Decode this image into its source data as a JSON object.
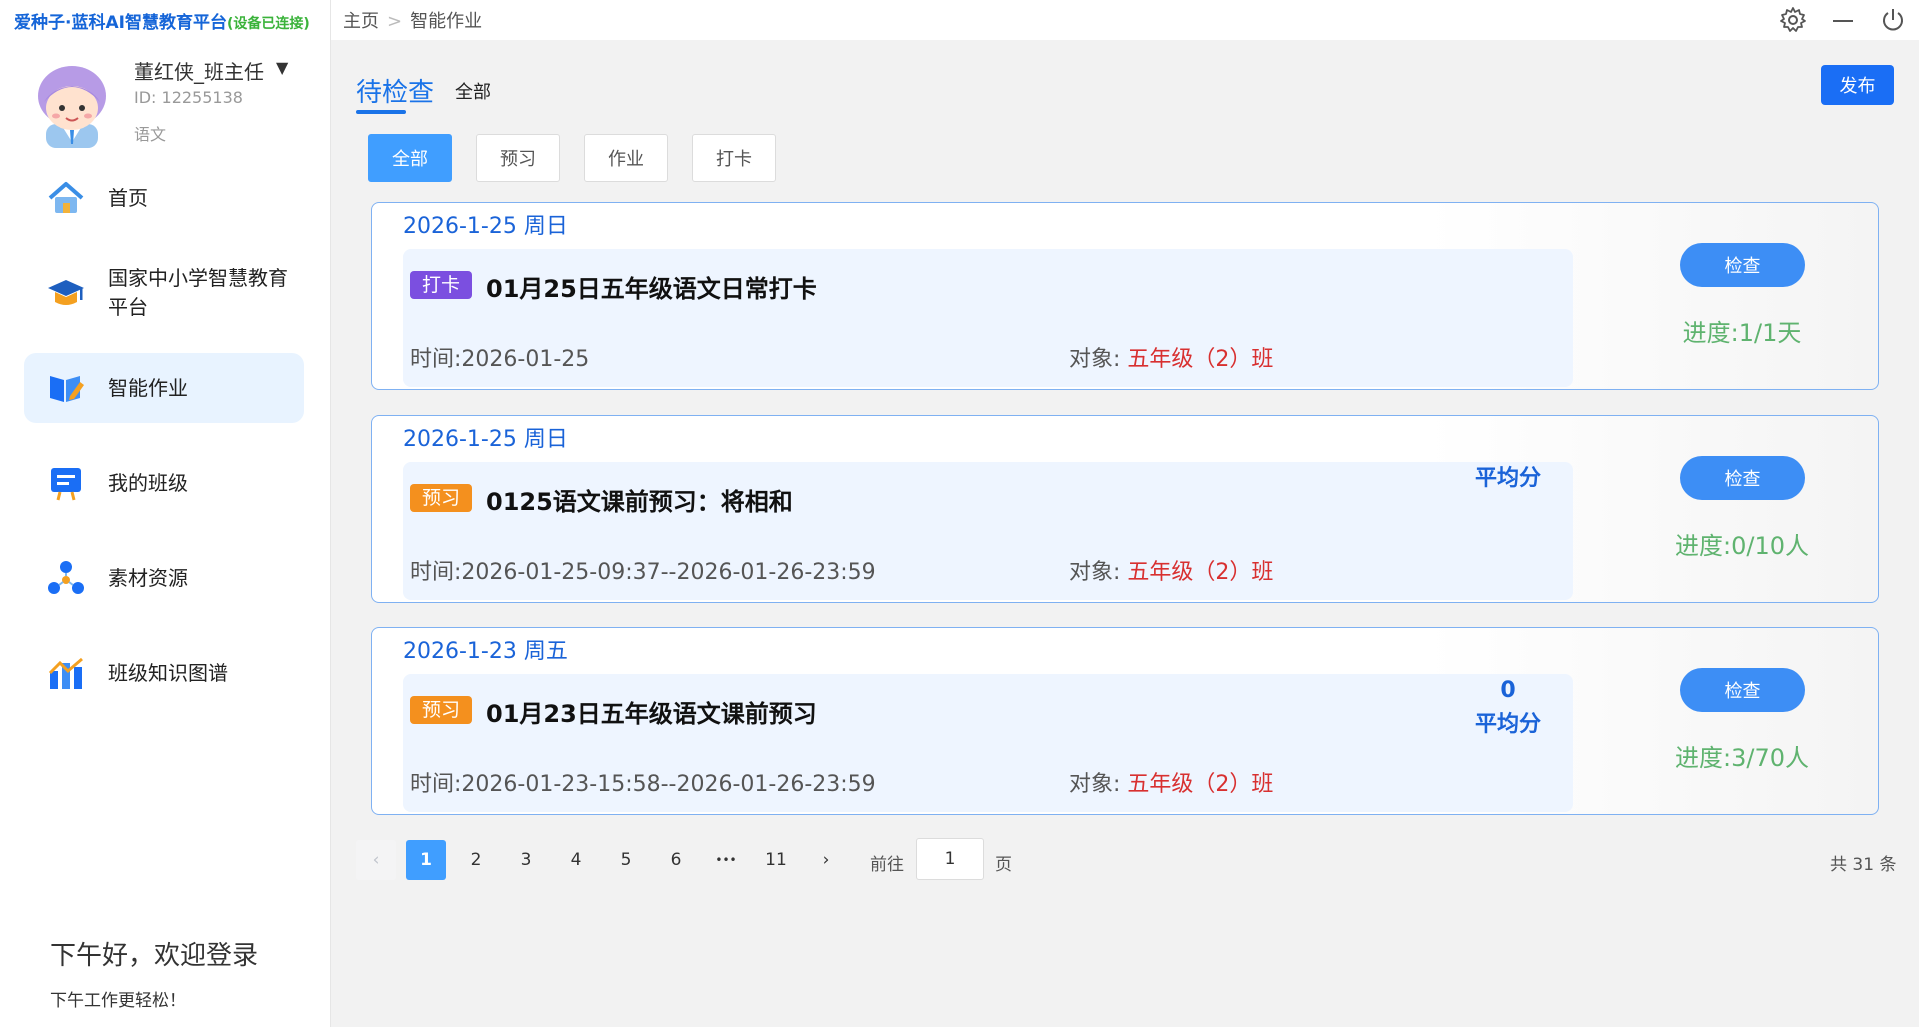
{
  "app": {
    "title": "爱种子·蓝科AI智慧教育平台",
    "connection": "(设备已连接)"
  },
  "user": {
    "name": "董红侠_班主任",
    "caret": "▼",
    "id": "ID: 12255138",
    "subject": "语文"
  },
  "nav": [
    {
      "label": "首页",
      "icon": "home-icon"
    },
    {
      "label": "国家中小学智慧教育平台",
      "icon": "graduation-cap-icon"
    },
    {
      "label": "智能作业",
      "icon": "book-pen-icon",
      "active": true
    },
    {
      "label": "我的班级",
      "icon": "class-board-icon"
    },
    {
      "label": "素材资源",
      "icon": "resources-icon"
    },
    {
      "label": "班级知识图谱",
      "icon": "chart-icon"
    }
  ],
  "greeting": {
    "title": "下午好，欢迎登录",
    "sub": "下午工作更轻松！"
  },
  "breadcrumb": {
    "home": "主页",
    "sep": ">",
    "current": "智能作业"
  },
  "tabs": {
    "pending": "待检查",
    "all": "全部"
  },
  "publish_label": "发布",
  "filters": [
    "全部",
    "预习",
    "作业",
    "打卡"
  ],
  "cards": [
    {
      "date": "2026-1-25 周日",
      "badge": "打卡",
      "badge_color": "#7b4fe0",
      "title": "01月25日五年级语文日常打卡",
      "time": "时间:2026-01-25",
      "target_label": "对象:",
      "target_class": "五年级（2）班",
      "avg_score": "",
      "avg_label": "",
      "check_label": "检查",
      "progress": "进度:1/1天"
    },
    {
      "date": "2026-1-25 周日",
      "badge": "预习",
      "badge_color": "#f4901e",
      "title": "0125语文课前预习：将相和",
      "time": "时间:2026-01-25-09:37--2026-01-26-23:59",
      "target_label": "对象:",
      "target_class": "五年级（2）班",
      "avg_score": "",
      "avg_label": "平均分",
      "check_label": "检查",
      "progress": "进度:0/10人"
    },
    {
      "date": "2026-1-23 周五",
      "badge": "预习",
      "badge_color": "#f4901e",
      "title": "01月23日五年级语文课前预习",
      "time": "时间:2026-01-23-15:58--2026-01-26-23:59",
      "target_label": "对象:",
      "target_class": "五年级（2）班",
      "avg_score": "0",
      "avg_label": "平均分",
      "check_label": "检查",
      "progress": "进度:3/70人"
    }
  ],
  "pagination": {
    "prev": "‹",
    "pages": [
      "1",
      "2",
      "3",
      "4",
      "5",
      "6",
      "•••",
      "11"
    ],
    "current": "1",
    "next": "›",
    "goto_label": "前往",
    "goto_value": "1",
    "page_label": "页",
    "total": "共 31 条"
  },
  "colors": {
    "primary": "#1a73e8",
    "publish": "#1a6ef5",
    "filter_active": "#409eff",
    "class_red": "#d83030",
    "progress_green": "#5fb36f"
  }
}
